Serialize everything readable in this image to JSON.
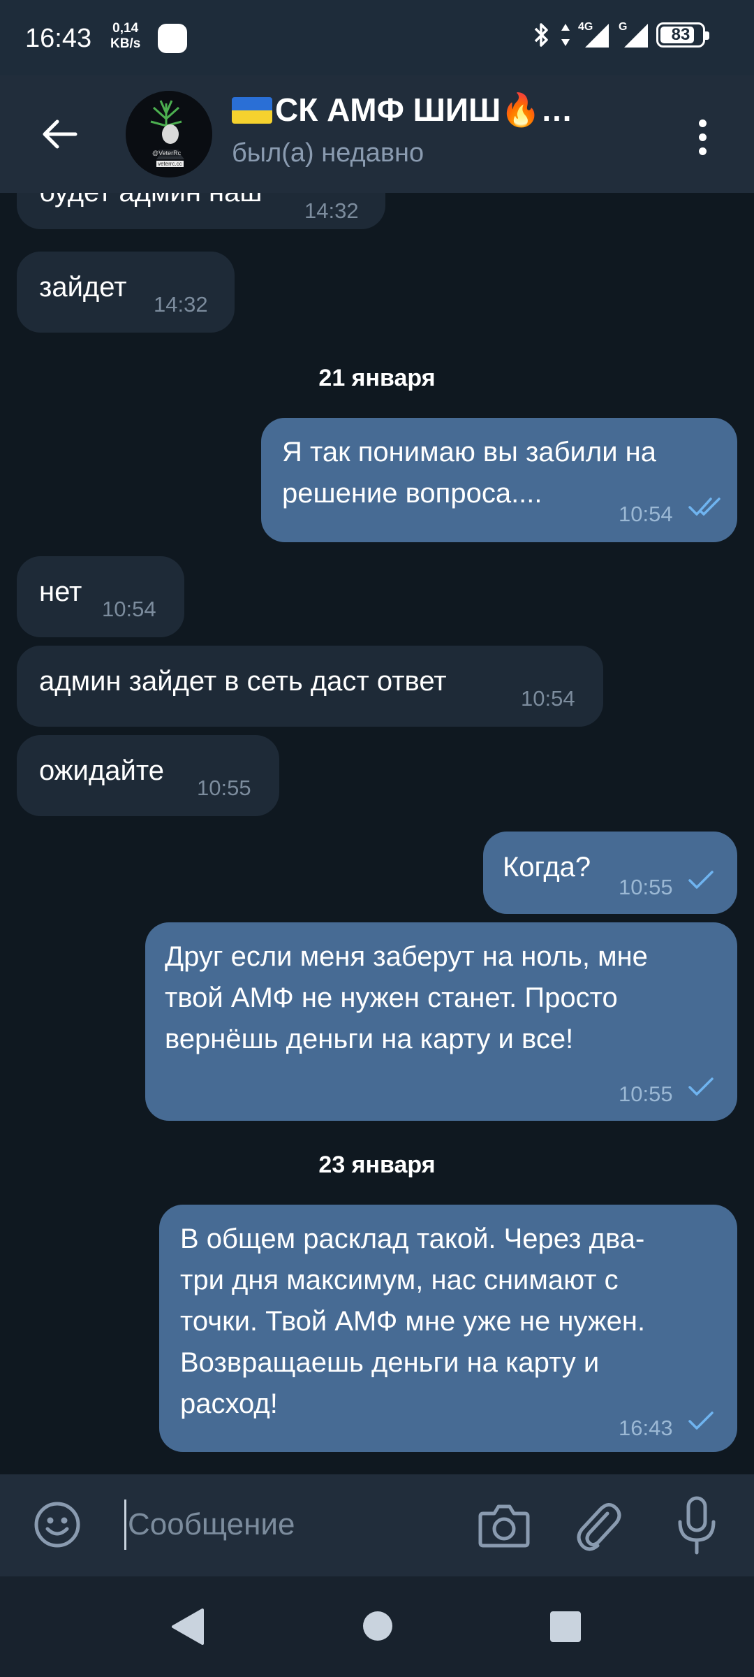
{
  "status_bar": {
    "time": "16:43",
    "speed_value": "0,14",
    "speed_unit": "KB/s",
    "network_4g": "4G",
    "network_g": "G",
    "battery": "83",
    "battery_level_percent": 83
  },
  "header": {
    "title": "СК АМФ ШИШ🔥…",
    "status": "был(а) недавно",
    "avatar_lines": [
      "@VeterRc",
      "veterrc.cc"
    ]
  },
  "messages": [
    {
      "dir": "in",
      "text": "будет админ наш",
      "time": "14:32"
    },
    {
      "dir": "in",
      "text": "зайдет",
      "time": "14:32"
    },
    {
      "type": "date",
      "text": "21 января"
    },
    {
      "dir": "out",
      "lines": [
        "Я так понимаю вы забили на",
        "решение вопроса...."
      ],
      "time": "10:54",
      "status": "read"
    },
    {
      "dir": "in",
      "text": "нет",
      "time": "10:54"
    },
    {
      "dir": "in",
      "text": "админ зайдет в сеть даст ответ",
      "time": "10:54"
    },
    {
      "dir": "in",
      "text": "ожидайте",
      "time": "10:55"
    },
    {
      "dir": "out",
      "text": "Когда?",
      "time": "10:55",
      "status": "sent"
    },
    {
      "dir": "out",
      "lines": [
        "Друг если меня заберут на ноль, мне",
        "твой АМФ не нужен станет. Просто",
        "вернёшь деньги на карту и все!"
      ],
      "time": "10:55",
      "status": "sent"
    },
    {
      "type": "date",
      "text": "23 января"
    },
    {
      "dir": "out",
      "lines": [
        "В общем расклад такой. Через два-",
        "три дня максимум, нас снимают с",
        "точки. Твой АМФ мне уже не нужен.",
        "Возвращаешь деньги на карту и",
        "расход!"
      ],
      "time": "16:43",
      "status": "sent"
    }
  ],
  "input": {
    "placeholder": "Сообщение"
  },
  "icons": {
    "back": "arrow-left-icon",
    "menu": "more-vertical-icon",
    "emoji": "emoji-icon",
    "camera": "camera-icon",
    "attach": "paperclip-icon",
    "mic": "microphone-icon"
  },
  "colors": {
    "chat_background": "#0f1820",
    "header": "#212d3b",
    "incoming_bubble": "#1e2a37",
    "outgoing_bubble": "#476b94",
    "tick": "#6fb4f0"
  }
}
